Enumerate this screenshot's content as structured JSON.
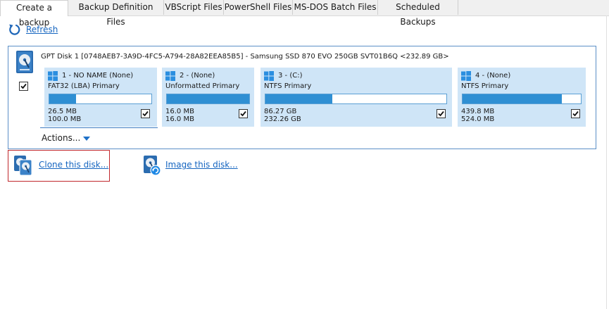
{
  "tabs": [
    {
      "label": "Create a backup",
      "active": true
    },
    {
      "label": "Backup Definition Files"
    },
    {
      "label": "VBScript Files"
    },
    {
      "label": "PowerShell Files"
    },
    {
      "label": "MS-DOS Batch Files"
    },
    {
      "label": "Scheduled Backups"
    }
  ],
  "toolbar": {
    "refresh_label": "Refresh"
  },
  "disk": {
    "title": "GPT Disk 1 [0748AEB7-3A9D-4FC5-A794-28A82EEA85B5] - Samsung SSD 870 EVO 250GB SVT01B6Q  <232.89 GB>",
    "checked": true,
    "partitions": [
      {
        "name": "1 - NO NAME (None)",
        "fs": "FAT32 (LBA) Primary",
        "used": "26.5 MB",
        "total": "100.0 MB",
        "fill_percent": 26,
        "checked": true
      },
      {
        "name": "2 -  (None)",
        "fs": "Unformatted Primary",
        "used": "16.0 MB",
        "total": "16.0 MB",
        "fill_percent": 100,
        "checked": true
      },
      {
        "name": "3 -  (C:)",
        "fs": "NTFS Primary",
        "used": "86.27 GB",
        "total": "232.26 GB",
        "fill_percent": 37,
        "checked": true
      },
      {
        "name": "4 -  (None)",
        "fs": "NTFS Primary",
        "used": "439.8 MB",
        "total": "524.0 MB",
        "fill_percent": 84,
        "checked": true
      }
    ],
    "actions_label": "Actions..."
  },
  "links": {
    "clone_label": "Clone this disk...",
    "image_label": "Image this disk..."
  },
  "colors": {
    "link": "#1565c0",
    "partition_bg": "#cfe5f7",
    "bar_fill": "#2f8fd3",
    "panel_border": "#5b8fc7",
    "highlight_border": "#c0282d"
  }
}
